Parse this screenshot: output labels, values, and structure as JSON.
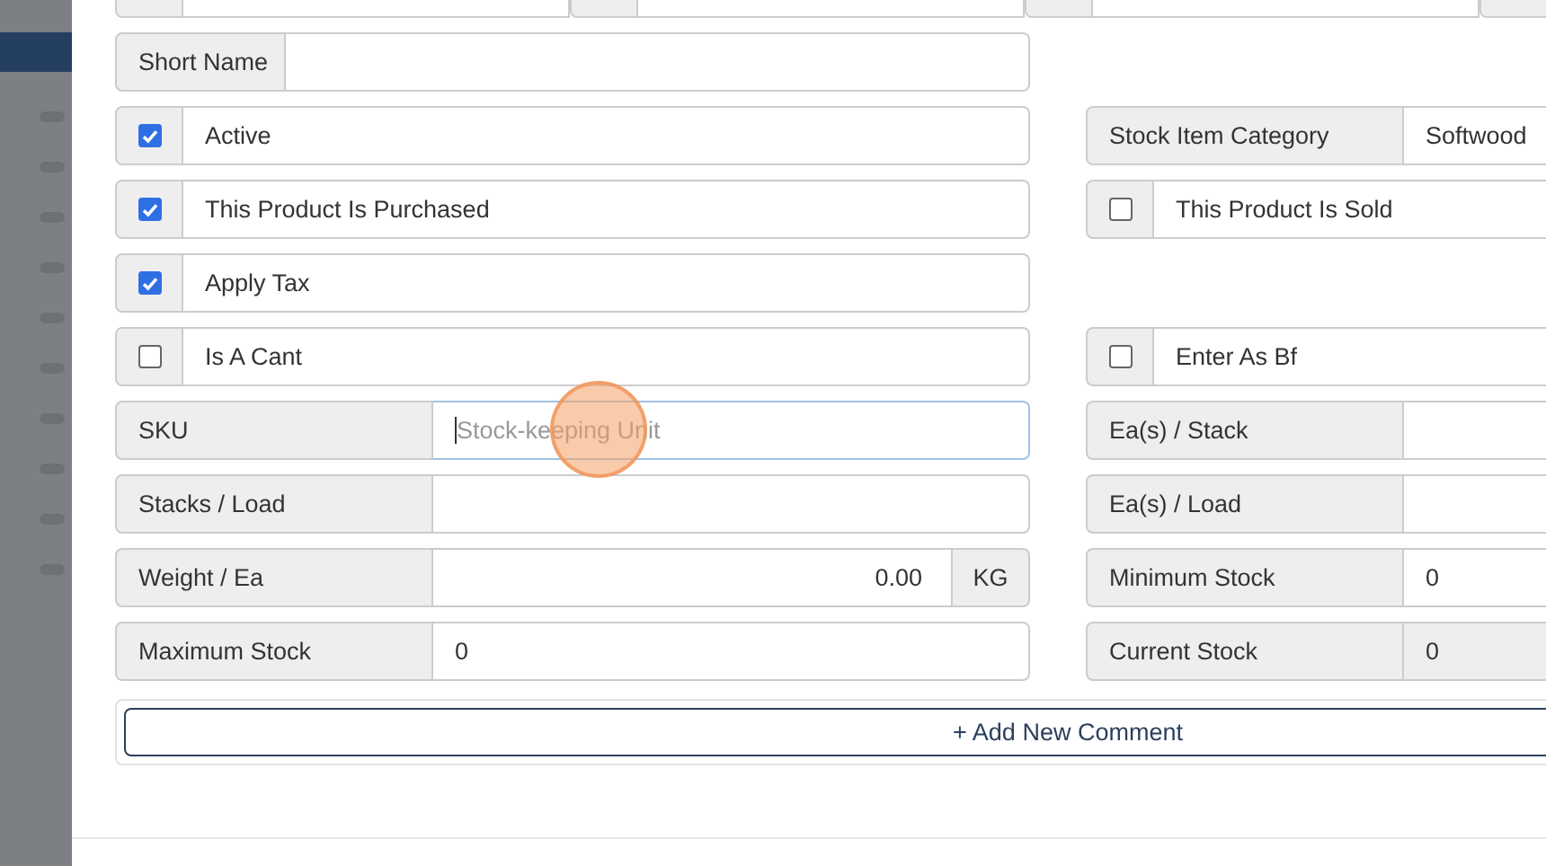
{
  "rows": [
    {
      "left": {
        "kind": "text",
        "label": "Short Name",
        "narrow": true
      },
      "right": null
    },
    {
      "left": {
        "kind": "checkbox",
        "label": "Active",
        "checked": true
      },
      "right": {
        "kind": "text",
        "label": "Stock Item Category",
        "value": "Softwood"
      }
    },
    {
      "left": {
        "kind": "checkbox",
        "label": "This Product Is Purchased",
        "checked": true
      },
      "right": {
        "kind": "checkbox",
        "label": "This Product Is Sold",
        "checked": false
      }
    },
    {
      "left": {
        "kind": "checkbox",
        "label": "Apply Tax",
        "checked": true
      },
      "right": null
    },
    {
      "left": {
        "kind": "checkbox",
        "label": "Is A Cant",
        "checked": false
      },
      "right": {
        "kind": "checkbox",
        "label": "Enter As Bf",
        "checked": false
      }
    },
    {
      "left": {
        "kind": "text",
        "label": "SKU",
        "placeholder": "Stock-keeping Unit",
        "focused": true
      },
      "right": {
        "kind": "text",
        "label": "Ea(s) / Stack"
      }
    },
    {
      "left": {
        "kind": "text",
        "label": "Stacks / Load"
      },
      "right": {
        "kind": "text",
        "label": "Ea(s) / Load"
      }
    },
    {
      "left": {
        "kind": "unit",
        "label": "Weight / Ea",
        "value": "0.00",
        "unit": "KG"
      },
      "right": {
        "kind": "text",
        "label": "Minimum Stock",
        "value": "0"
      }
    },
    {
      "left": {
        "kind": "text",
        "label": "Maximum Stock",
        "value": "0"
      },
      "right": {
        "kind": "text",
        "label": "Current Stock",
        "value": "0",
        "disabled": true
      }
    }
  ],
  "comment_button": "+ Add New Comment"
}
